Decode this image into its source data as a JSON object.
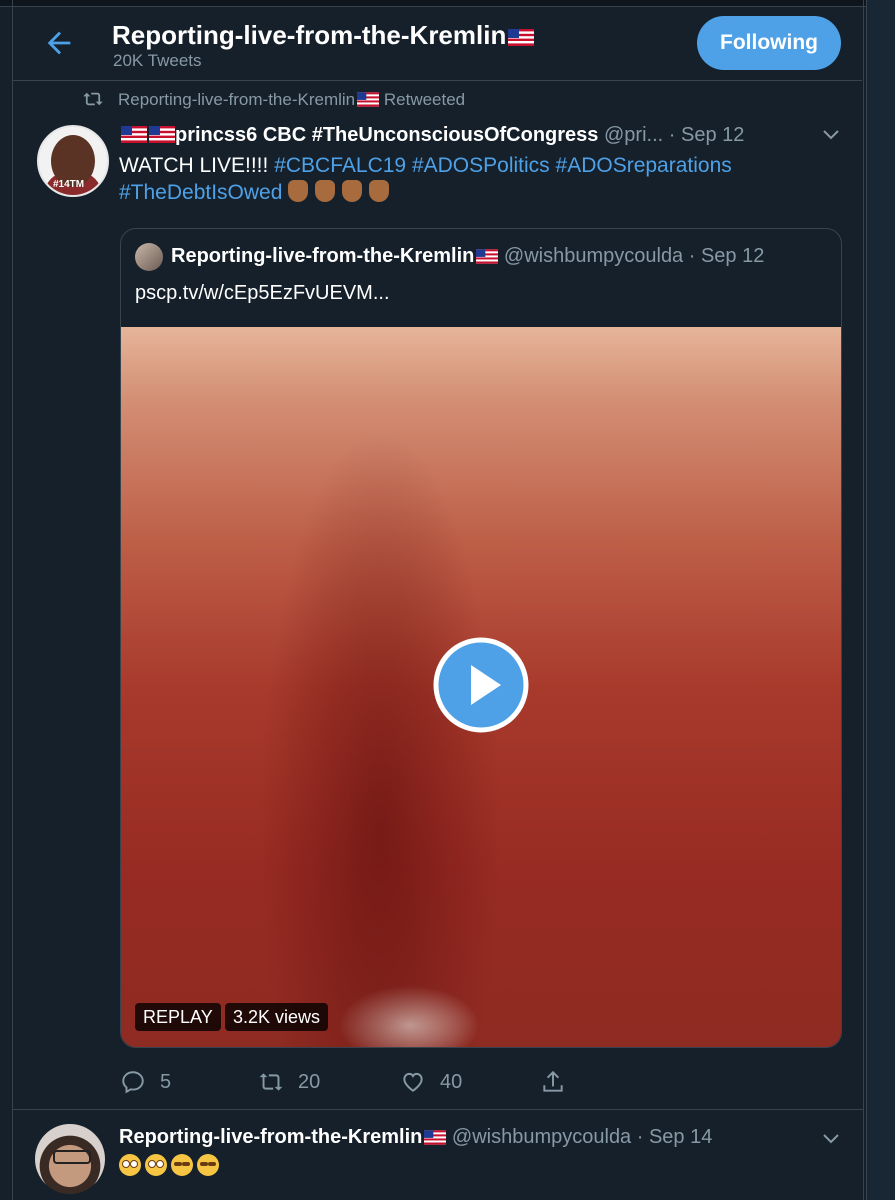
{
  "header": {
    "title": "Reporting-live-from-the-Kremlin",
    "tweet_count": "20K Tweets",
    "follow_label": "Following"
  },
  "tweet": {
    "retweet_context": "Reporting-live-from-the-Kremlin",
    "retweet_suffix": "Retweeted",
    "author_name": "princss6 CBC #TheUnconsciousOfCongress",
    "author_handle": "@pri...",
    "date": "· Sep 12",
    "avatar_tag": "#14TM",
    "text_plain": "WATCH LIVE!!!!",
    "hashtags": [
      "#CBCFALC19",
      "#ADOSPolitics",
      "#ADOSreparations",
      "#TheDebtIsOwed"
    ],
    "quote": {
      "author_name": "Reporting-live-from-the-Kremlin",
      "author_handle": "@wishbumpycoulda",
      "date": "· Sep 12",
      "text": "pscp.tv/w/cEp5EzFvUEVM...",
      "replay_label": "REPLAY",
      "views_label": "3.2K views"
    },
    "actions": {
      "replies": "5",
      "retweets": "20",
      "likes": "40"
    }
  },
  "tweet2": {
    "author_name": "Reporting-live-from-the-Kremlin",
    "author_handle": "@wishbumpycoulda",
    "date": "· Sep 14"
  },
  "colors": {
    "background": "#15202b",
    "accent": "#4ea1e6",
    "secondary_text": "#8899a6",
    "border": "#38444d"
  },
  "icons": [
    "back-arrow-icon",
    "us-flag-icon",
    "retweet-icon",
    "chevron-down-icon",
    "play-icon",
    "reply-icon",
    "like-icon",
    "share-icon"
  ]
}
